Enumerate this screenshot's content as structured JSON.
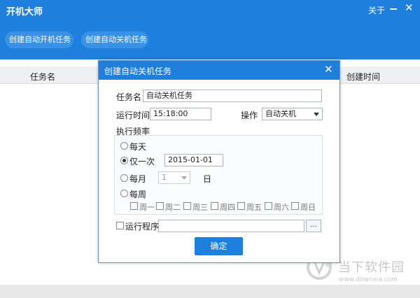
{
  "app": {
    "title": "开机大师",
    "about": "关于",
    "close_glyph": "✕"
  },
  "toolbar": {
    "create_startup": "创建自动开机任务",
    "create_shutdown": "创建自动关机任务"
  },
  "table": {
    "col_task_name": "任务名",
    "col_created_time": "创建时间"
  },
  "dialog": {
    "title": "创建自动关机任务",
    "close_glyph": "✕",
    "task_name_label": "任务名",
    "task_name_value": "自动关机任务",
    "run_time_label": "运行时间",
    "run_time_value": "15:18:00",
    "operation_label": "操作",
    "operation_value": "自动关机",
    "frequency_label": "执行频率",
    "freq_daily": "每天",
    "freq_once": "仅一次",
    "once_date": "2015-01-01",
    "freq_monthly": "每月",
    "month_day": "1",
    "day_suffix": "日",
    "freq_weekly": "每周",
    "weekdays": [
      "周一",
      "周二",
      "周三",
      "周四",
      "周五",
      "周六",
      "周日"
    ],
    "run_program_label": "运行程序",
    "run_program_value": "",
    "browse_label": "...",
    "confirm_label": "确定"
  },
  "watermark": {
    "name": "当下软件园",
    "url": "www.downxia.com"
  },
  "colors": {
    "brand_blue": "#1f7fdd",
    "header_gray": "#eef0f3"
  },
  "state": {
    "selected_frequency": "仅一次",
    "run_program_checked": false
  }
}
